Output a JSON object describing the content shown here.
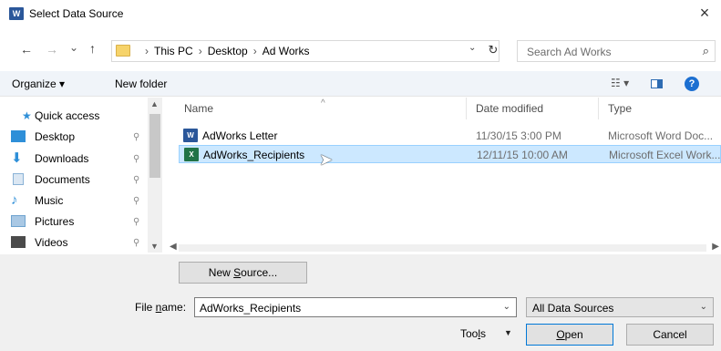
{
  "window": {
    "title": "Select Data Source",
    "app_icon_letter": "W",
    "close_glyph": "×"
  },
  "nav": {
    "back": "←",
    "forward": "→",
    "recent": "⌄",
    "up": "↑",
    "breadcrumbs": [
      "This PC",
      "Desktop",
      "Ad Works"
    ],
    "separator": "›",
    "address_dropdown": "⌄",
    "refresh": "↻",
    "search_placeholder": "Search Ad Works",
    "search_icon": "⌕"
  },
  "toolbar": {
    "organize": "Organize ▾",
    "new_folder": "New folder",
    "view_glyph": "☷ ▾",
    "help": "?"
  },
  "sidebar": {
    "quick_access": "Quick access",
    "items": [
      {
        "label": "Desktop",
        "icon": "desktop-icon",
        "color": "#2e8fd8"
      },
      {
        "label": "Downloads",
        "icon": "downloads-icon",
        "color": "#2e8fd8"
      },
      {
        "label": "Documents",
        "icon": "documents-icon",
        "color": "#8ab2d6"
      },
      {
        "label": "Music",
        "icon": "music-icon",
        "color": "#2e8fd8"
      },
      {
        "label": "Pictures",
        "icon": "pictures-icon",
        "color": "#6ea3cf"
      },
      {
        "label": "Videos",
        "icon": "videos-icon",
        "color": "#4b4b4b"
      }
    ],
    "pin_glyph": "⚲"
  },
  "file_list": {
    "columns": {
      "name": "Name",
      "date": "Date modified",
      "type": "Type"
    },
    "sort_caret": "^",
    "rows": [
      {
        "name": "AdWorks Letter",
        "date": "11/30/15 3:00 PM",
        "type": "Microsoft Word Doc...",
        "icon": "word-file-icon",
        "icon_letter": "W",
        "icon_color": "#2b579a",
        "selected": false
      },
      {
        "name": "AdWorks_Recipients",
        "date": "12/11/15 10:00 AM",
        "type": "Microsoft Excel Work...",
        "icon": "excel-file-icon",
        "icon_letter": "X",
        "icon_color": "#217346",
        "selected": true
      }
    ]
  },
  "bottom": {
    "new_source_pre": "New ",
    "new_source_u": "S",
    "new_source_post": "ource...",
    "file_name_label_pre": "File ",
    "file_name_label_u": "n",
    "file_name_label_post": "ame:",
    "file_name_value": "AdWorks_Recipients",
    "filter_value": "All Data Sources",
    "tools_pre": "Too",
    "tools_u": "l",
    "tools_post": "s",
    "open_u": "O",
    "open_post": "pen",
    "cancel": "Cancel"
  }
}
